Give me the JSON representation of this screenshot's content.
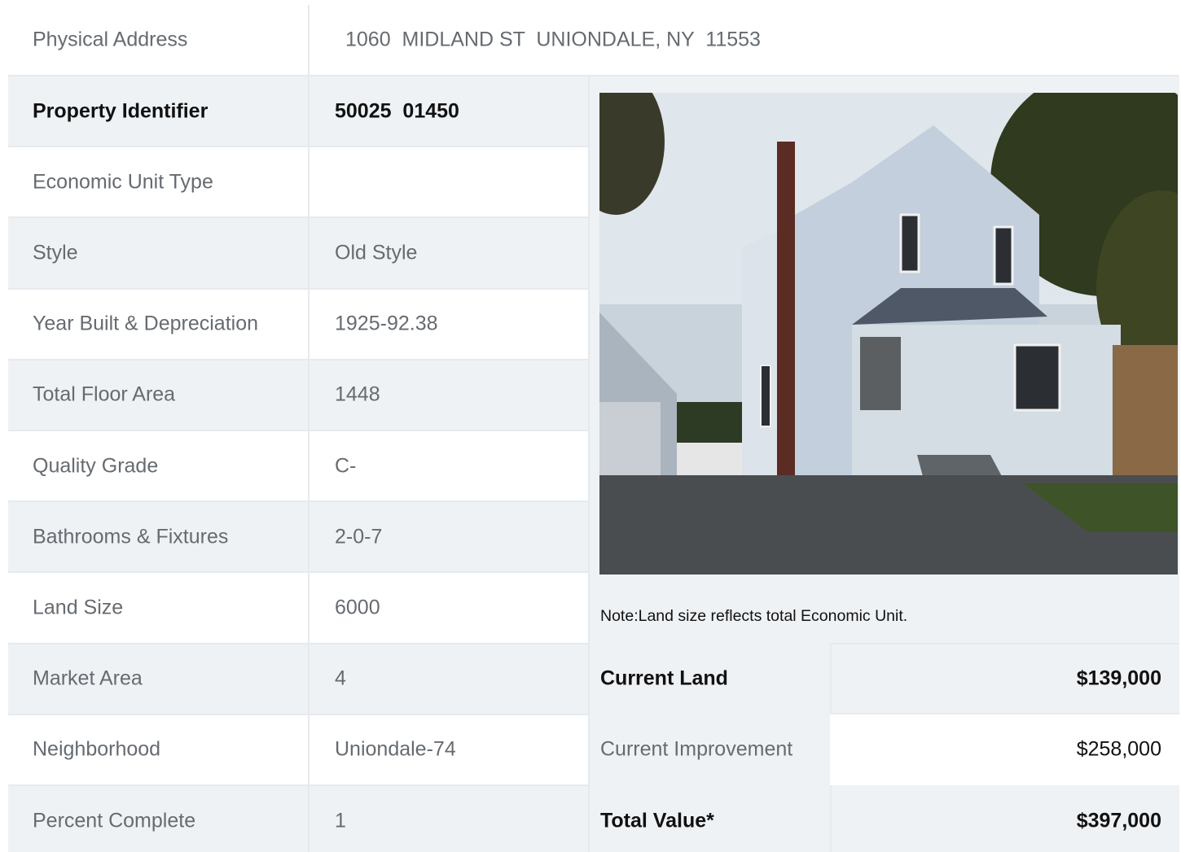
{
  "address": {
    "label": "Physical Address",
    "value": "1060  MIDLAND ST  UNIONDALE, NY  11553"
  },
  "details": [
    {
      "label": "Property Identifier",
      "value": "50025  01450",
      "bold": true
    },
    {
      "label": "Economic Unit Type",
      "value": ""
    },
    {
      "label": "Style",
      "value": "Old Style"
    },
    {
      "label": "Year Built & Depreciation",
      "value": "1925-92.38"
    },
    {
      "label": "Total Floor Area",
      "value": "1448"
    },
    {
      "label": "Quality Grade",
      "value": "C-"
    },
    {
      "label": "Bathrooms & Fixtures",
      "value": "2-0-7"
    },
    {
      "label": "Land Size",
      "value": "6000"
    },
    {
      "label": "Market Area",
      "value": "4"
    },
    {
      "label": "Neighborhood",
      "value": "Uniondale-74"
    },
    {
      "label": "Percent Complete",
      "value": "1"
    }
  ],
  "note": "Note:Land size reflects total Economic Unit.",
  "valuation": [
    {
      "label": "Current Land",
      "value": "$139,000",
      "bold": true
    },
    {
      "label": "Current Improvement",
      "value": "$258,000"
    },
    {
      "label": "Total Value*",
      "value": "$397,000",
      "bold": true
    }
  ],
  "photo_icon": "house-photo"
}
